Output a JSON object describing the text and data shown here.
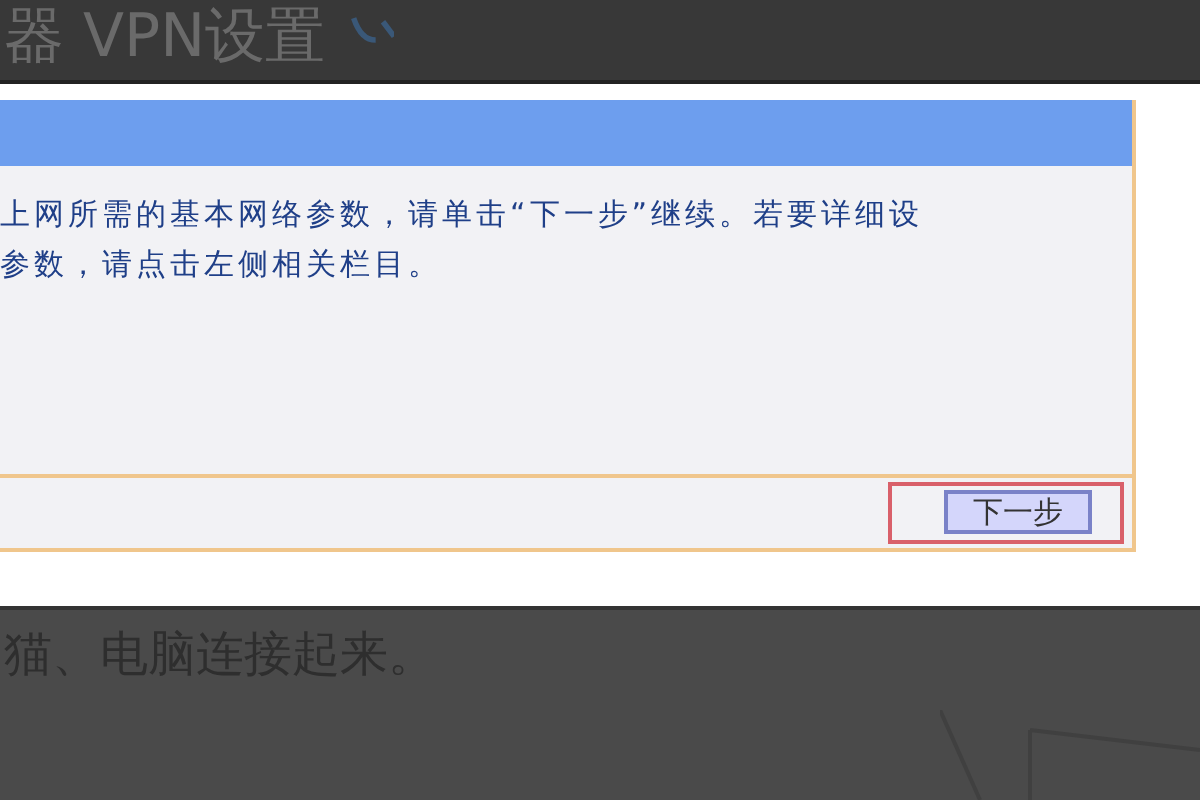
{
  "heading": {
    "text": "器 VPN设置"
  },
  "router_panel": {
    "lines": [
      "上网所需的基本网络参数，请单击“下一步”继续。若要详细设",
      "参数，请点击左侧相关栏目。"
    ],
    "next_button": "下一步"
  },
  "caption": "猫、电脑连接起来。"
}
